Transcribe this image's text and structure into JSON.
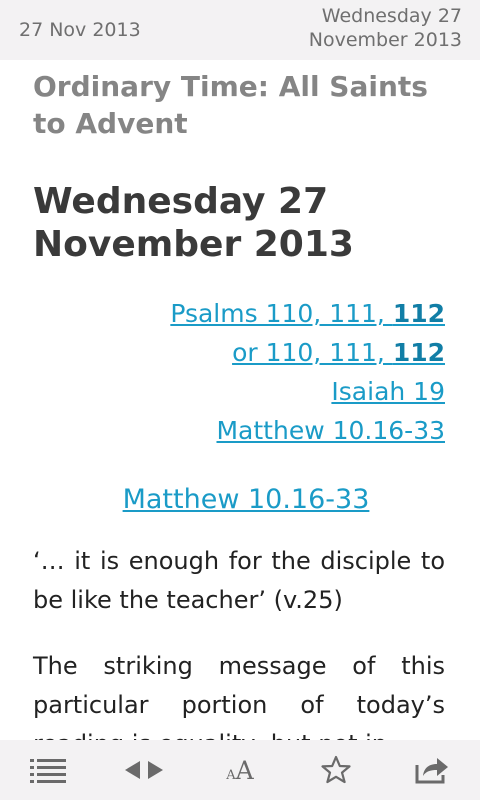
{
  "header": {
    "date": "27 Nov 2013",
    "title": "Wednesday 27 November 2013"
  },
  "content": {
    "season": "Ordinary Time: All Saints to Advent",
    "day_title": "Wednesday 27 November 2013",
    "readings": [
      {
        "text": "Psalms 110, 111, ",
        "bold": "112"
      },
      {
        "text": "or 110, 111, ",
        "bold": "112"
      },
      {
        "text": "Isaiah 19",
        "bold": ""
      },
      {
        "text": "Matthew 10.16-33",
        "bold": ""
      }
    ],
    "passage_title": "Matthew 10.16-33",
    "quote": "‘… it is enough for the disciple to be like the teacher’ (v.25)",
    "body": "The striking message of this particular portion of today’s reading is equality, but not in"
  },
  "toolbar": {
    "font_size_small": "A",
    "font_size_large": "A",
    "icons": [
      "list-icon",
      "prev-next-arrows-icon",
      "font-size-icon",
      "star-icon",
      "share-icon"
    ]
  },
  "colors": {
    "link": "#1a9bc7",
    "bar_background": "#f3f2f3",
    "icon": "#6a6a6a"
  }
}
